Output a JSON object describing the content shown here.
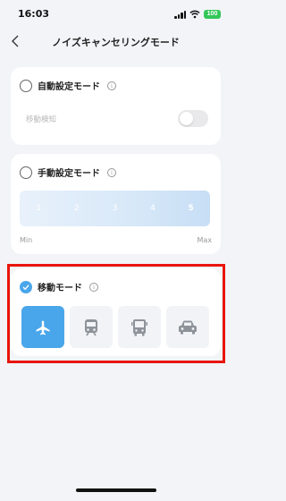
{
  "status": {
    "time": "16:03",
    "battery": "100"
  },
  "nav": {
    "title": "ノイズキャンセリングモード"
  },
  "auto_mode": {
    "label": "自動設定モード",
    "sub_label": "移動検知",
    "toggle_on": false
  },
  "manual_mode": {
    "label": "手動設定モード",
    "levels": [
      "1",
      "2",
      "3",
      "4",
      "5"
    ],
    "selected_level": "5",
    "min_label": "Min",
    "max_label": "Max"
  },
  "moving_mode": {
    "label": "移動モード",
    "selected": true,
    "options": [
      "airplane-icon",
      "train-icon",
      "bus-icon",
      "car-icon"
    ],
    "selected_option": "airplane-icon"
  },
  "colors": {
    "accent": "#4aa6ea",
    "highlight": "#e8150b"
  }
}
